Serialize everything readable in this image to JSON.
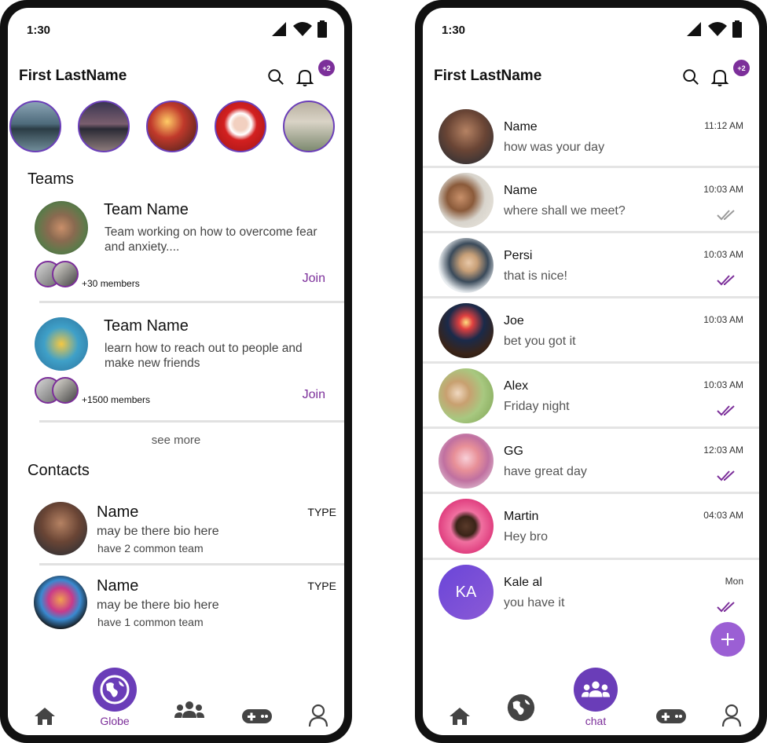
{
  "left": {
    "status_time": "1:30",
    "title": "First LastName",
    "bell_badge": "+2",
    "teams_title": "Teams",
    "teams": [
      {
        "name": "Team Name",
        "desc": "Team working on how to overcome fear and anxiety....",
        "members": "+30 members",
        "join": "Join"
      },
      {
        "name": "Team Name",
        "desc": "learn how to reach out to people and make new friends",
        "members": "+1500 members",
        "join": "Join"
      }
    ],
    "see_more": "see more",
    "contacts_title": "Contacts",
    "contacts": [
      {
        "name": "Name",
        "bio": "may be there bio here",
        "common": "have 2 common team",
        "type": "TYPE"
      },
      {
        "name": "Name",
        "bio": "may be there bio here",
        "common": "have 1 common team",
        "type": "TYPE"
      }
    ],
    "nav": {
      "active_label": "Globe"
    }
  },
  "right": {
    "status_time": "1:30",
    "title": "First LastName",
    "bell_badge": "+2",
    "chats": [
      {
        "name": "Name",
        "msg": "how was your day",
        "time": "11:12 AM",
        "check": "none"
      },
      {
        "name": "Name",
        "msg": "where shall we meet?",
        "time": "10:03 AM",
        "check": "grey"
      },
      {
        "name": "Persi",
        "msg": "that is nice!",
        "time": "10:03 AM",
        "check": "purple"
      },
      {
        "name": "Joe",
        "msg": "bet you got it",
        "time": "10:03 AM",
        "check": "none"
      },
      {
        "name": "Alex",
        "msg": "Friday night",
        "time": "10:03 AM",
        "check": "purple"
      },
      {
        "name": "GG",
        "msg": "have great day",
        "time": "12:03 AM",
        "check": "purple"
      },
      {
        "name": "Martin",
        "msg": "Hey bro",
        "time": "04:03 AM",
        "check": "none"
      },
      {
        "name": "Kale al",
        "msg": "you have it",
        "time": "Mon",
        "check": "purple",
        "initials": "KA"
      }
    ],
    "nav": {
      "active_label": "chat"
    }
  },
  "colors": {
    "accent": "#7c2f9a",
    "active_nav": "#6a3db8",
    "fab": "#9b5fd4"
  }
}
